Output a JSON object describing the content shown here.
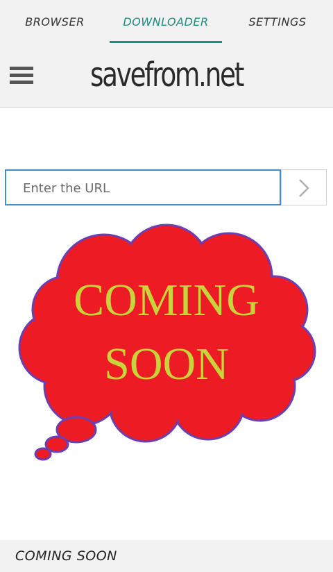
{
  "tabs": [
    {
      "label": "BROWSER"
    },
    {
      "label": "DOWNLOADER",
      "active": true
    },
    {
      "label": "SETTINGS"
    }
  ],
  "header": {
    "logo_text": "savefrom.net",
    "menu_icon": "hamburger-menu-icon"
  },
  "search": {
    "placeholder": "Enter the URL",
    "go_icon": "chevron-right-icon"
  },
  "banner": {
    "line1": "COMING",
    "line2": "SOON"
  },
  "footer": {
    "text": "COMING SOON"
  },
  "colors": {
    "accent": "#1f8a7d",
    "input_border": "#3f8fd0",
    "cloud_fill": "#ed1c24",
    "cloud_outline": "#6a3fb2",
    "banner_text": "#c8d43a"
  }
}
